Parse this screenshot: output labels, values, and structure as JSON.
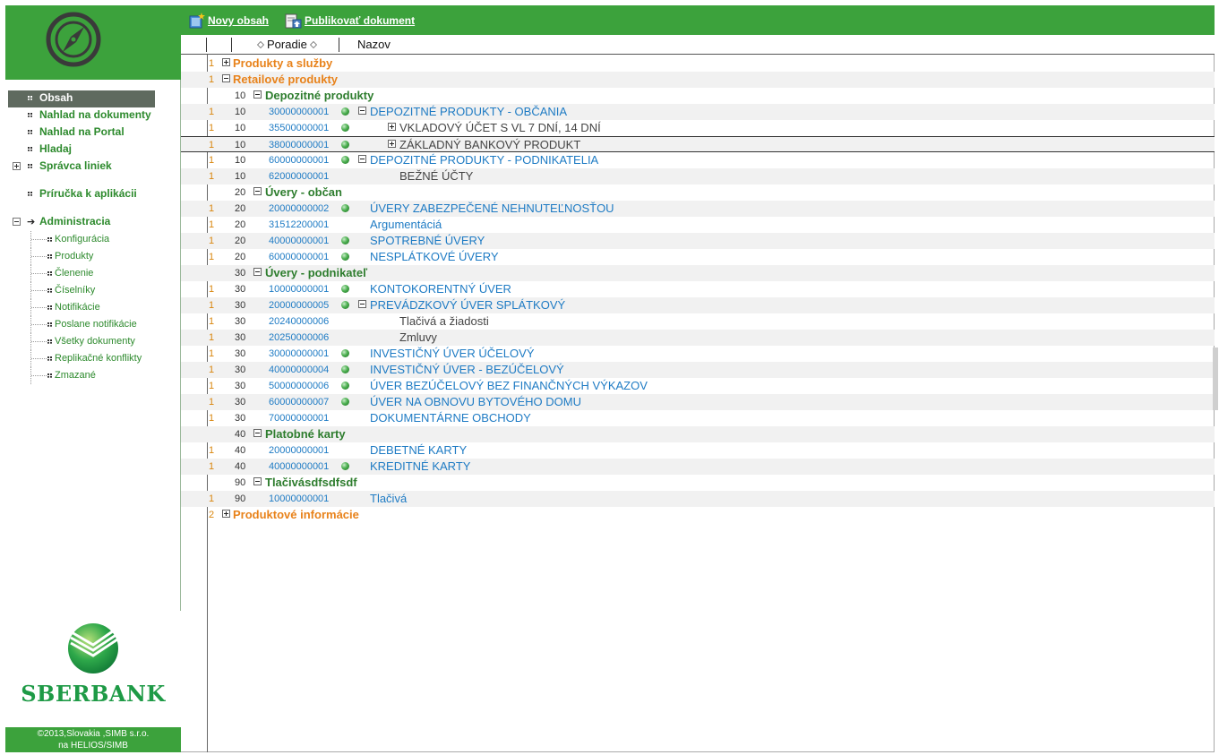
{
  "sidebar": {
    "nav": [
      {
        "label": "Obsah",
        "selected": true
      },
      {
        "label": "Nahlad na dokumenty"
      },
      {
        "label": "Nahlad na Portal"
      },
      {
        "label": "Hladaj"
      },
      {
        "label": "Správca liniek"
      }
    ],
    "help_label": "Príručka k aplikácii",
    "admin": {
      "label": "Administracia",
      "items": [
        "Konfigurácia",
        "Produkty",
        "Členenie",
        "Číselníky",
        "Notifikácie",
        "Poslane notifikácie",
        "Všetky dokumenty",
        "Replikačné konflikty",
        "Zmazané"
      ]
    },
    "brand": "SBERBANK",
    "footer_line1": "©2013,Slovakia ,SIMB s.r.o.",
    "footer_line2": "na HELIOS/SIMB"
  },
  "toolbar": {
    "new_label": "Novy obsah",
    "publish_label": "Publikovať dokument"
  },
  "table": {
    "col_order": "Poradie",
    "col_name": "Nazov",
    "rows": [
      {
        "lvl": "1",
        "ord": "",
        "code": "",
        "name": "Produkty a služby",
        "style": "orange",
        "toggle": "plus",
        "ball": false
      },
      {
        "lvl": "1",
        "ord": "",
        "code": "",
        "name": "Retailové produkty",
        "style": "orange",
        "toggle": "minus",
        "ball": false
      },
      {
        "lvl": "",
        "ord": "10",
        "code": "",
        "name": "Depozitné produkty",
        "style": "green",
        "toggle": "minus",
        "ball": false
      },
      {
        "lvl": "1",
        "ord": "10",
        "code": "30000000001",
        "name": "DEPOZITNÉ PRODUKTY - OBČANIA",
        "style": "blue",
        "toggle": "minus",
        "ball": true
      },
      {
        "lvl": "1",
        "ord": "10",
        "code": "35500000001",
        "name": "VKLADOVÝ ÚČET S VL 7 DNÍ, 14 DNÍ",
        "style": "grey",
        "toggle": "plus",
        "ball": true
      },
      {
        "lvl": "1",
        "ord": "10",
        "code": "38000000001",
        "name": "ZÁKLADNÝ BANKOVÝ PRODUKT",
        "style": "grey",
        "toggle": "plus",
        "ball": true,
        "bordered": true
      },
      {
        "lvl": "1",
        "ord": "10",
        "code": "60000000001",
        "name": "DEPOZITNÉ PRODUKTY - PODNIKATELIA",
        "style": "blue",
        "toggle": "minus",
        "ball": true
      },
      {
        "lvl": "1",
        "ord": "10",
        "code": "62000000001",
        "name": "BEŽNÉ ÚČTY",
        "style": "grey",
        "toggle": "",
        "ball": false
      },
      {
        "lvl": "",
        "ord": "20",
        "code": "",
        "name": "Úvery - občan",
        "style": "green",
        "toggle": "minus",
        "ball": false
      },
      {
        "lvl": "1",
        "ord": "20",
        "code": "20000000002",
        "name": "ÚVERY ZABEZPEČENÉ NEHNUTEĽNOSŤOU",
        "style": "blue",
        "toggle": "",
        "ball": true
      },
      {
        "lvl": "1",
        "ord": "20",
        "code": "31512200001",
        "name": "Argumentáciá",
        "style": "blue",
        "toggle": "",
        "ball": false
      },
      {
        "lvl": "1",
        "ord": "20",
        "code": "40000000001",
        "name": "SPOTREBNÉ ÚVERY",
        "style": "blue",
        "toggle": "",
        "ball": true
      },
      {
        "lvl": "1",
        "ord": "20",
        "code": "60000000001",
        "name": "NESPLÁTKOVÉ ÚVERY",
        "style": "blue",
        "toggle": "",
        "ball": true
      },
      {
        "lvl": "",
        "ord": "30",
        "code": "",
        "name": "Úvery - podnikateľ",
        "style": "green",
        "toggle": "minus",
        "ball": false
      },
      {
        "lvl": "1",
        "ord": "30",
        "code": "10000000001",
        "name": "KONTOKORENTNÝ ÚVER",
        "style": "blue",
        "toggle": "",
        "ball": true
      },
      {
        "lvl": "1",
        "ord": "30",
        "code": "20000000005",
        "name": "PREVÁDZKOVÝ ÚVER SPLÁTKOVÝ",
        "style": "blue",
        "toggle": "minus",
        "ball": true
      },
      {
        "lvl": "1",
        "ord": "30",
        "code": "20240000006",
        "name": "Tlačivá a žiadosti",
        "style": "grey",
        "toggle": "",
        "ball": false
      },
      {
        "lvl": "1",
        "ord": "30",
        "code": "20250000006",
        "name": "Zmluvy",
        "style": "grey",
        "toggle": "",
        "ball": false
      },
      {
        "lvl": "1",
        "ord": "30",
        "code": "30000000001",
        "name": "INVESTIČNÝ ÚVER ÚČELOVÝ",
        "style": "blue",
        "toggle": "",
        "ball": true
      },
      {
        "lvl": "1",
        "ord": "30",
        "code": "40000000004",
        "name": "INVESTIČNÝ ÚVER - BEZÚČELOVÝ",
        "style": "blue",
        "toggle": "",
        "ball": true
      },
      {
        "lvl": "1",
        "ord": "30",
        "code": "50000000006",
        "name": "ÚVER BEZÚČELOVÝ BEZ FINANČNÝCH VÝKAZOV",
        "style": "blue",
        "toggle": "",
        "ball": true
      },
      {
        "lvl": "1",
        "ord": "30",
        "code": "60000000007",
        "name": "ÚVER NA OBNOVU BYTOVÉHO DOMU",
        "style": "blue",
        "toggle": "",
        "ball": true
      },
      {
        "lvl": "1",
        "ord": "30",
        "code": "70000000001",
        "name": "DOKUMENTÁRNE OBCHODY",
        "style": "blue",
        "toggle": "",
        "ball": false
      },
      {
        "lvl": "",
        "ord": "40",
        "code": "",
        "name": "Platobné karty",
        "style": "green",
        "toggle": "minus",
        "ball": false
      },
      {
        "lvl": "1",
        "ord": "40",
        "code": "20000000001",
        "name": "DEBETNÉ KARTY",
        "style": "blue",
        "toggle": "",
        "ball": false
      },
      {
        "lvl": "1",
        "ord": "40",
        "code": "40000000001",
        "name": "KREDITNÉ KARTY",
        "style": "blue",
        "toggle": "",
        "ball": true
      },
      {
        "lvl": "",
        "ord": "90",
        "code": "",
        "name": "Tlačivásdfsdfsdf",
        "style": "green",
        "toggle": "minus",
        "ball": false
      },
      {
        "lvl": "1",
        "ord": "90",
        "code": "10000000001",
        "name": "Tlačivá",
        "style": "blue",
        "toggle": "",
        "ball": false
      },
      {
        "lvl": "2",
        "ord": "",
        "code": "",
        "name": "Produktové informácie",
        "style": "orange",
        "toggle": "plus",
        "ball": false
      }
    ]
  },
  "colors": {
    "brand_green": "#3ca23c",
    "link_blue": "#1e7bc4",
    "category_orange": "#e8821a",
    "group_green": "#2e7d2e"
  }
}
